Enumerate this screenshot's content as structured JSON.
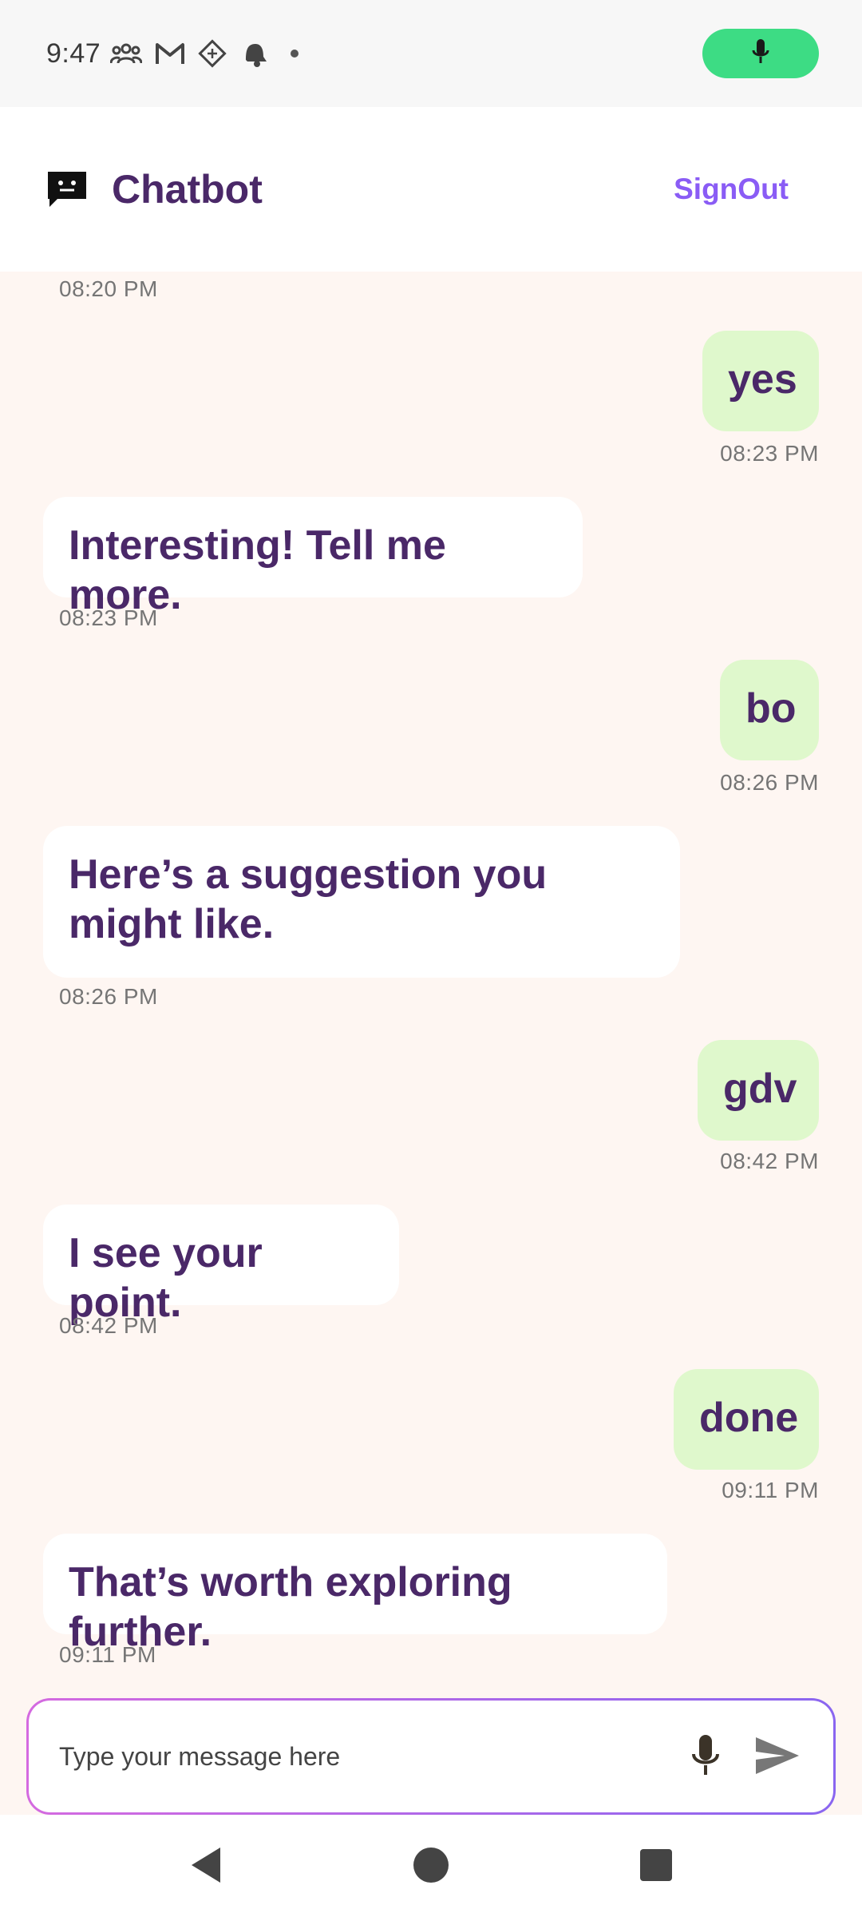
{
  "status_bar": {
    "time": "9:47"
  },
  "app_bar": {
    "title": "Chatbot",
    "signout_label": "SignOut"
  },
  "messages": [
    {
      "from": "bot",
      "text": "",
      "time": "08:20 PM"
    },
    {
      "from": "user",
      "text": "yes",
      "time": "08:23 PM"
    },
    {
      "from": "bot",
      "text": "Interesting! Tell me more.",
      "time": "08:23 PM"
    },
    {
      "from": "user",
      "text": "bo",
      "time": "08:26 PM"
    },
    {
      "from": "bot",
      "text": "Here’s a suggestion you might like.",
      "time": "08:26 PM"
    },
    {
      "from": "user",
      "text": "gdv",
      "time": "08:42 PM"
    },
    {
      "from": "bot",
      "text": "I see your point.",
      "time": "08:42 PM"
    },
    {
      "from": "user",
      "text": "done",
      "time": "09:11 PM"
    },
    {
      "from": "bot",
      "text": "That’s worth exploring further.",
      "time": "09:11 PM"
    }
  ],
  "input": {
    "placeholder": "Type your message here",
    "value": ""
  },
  "colors": {
    "accent": "#8a5cf5",
    "title": "#4a2868",
    "user_bubble": "#dff8cc",
    "bot_bubble": "#ffffff",
    "chat_background": "#fef6f2",
    "mic_indicator": "#3ddc84"
  },
  "icons": {
    "status": [
      "people-icon",
      "gmail-icon",
      "diamond-icon",
      "notification-icon"
    ],
    "app_logo": "chat-bubble-icon",
    "mic": "microphone-icon",
    "send": "send-icon",
    "nav": [
      "back-icon",
      "home-icon",
      "recents-icon"
    ]
  }
}
